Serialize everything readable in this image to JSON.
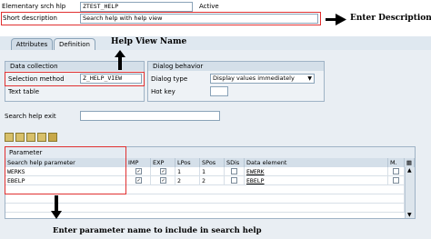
{
  "header": {
    "elem_label": "Elementary srch hlp",
    "elem_value": "ZTEST_HELP",
    "status": "Active",
    "short_desc_label": "Short description",
    "short_desc_value": "Search help with help view"
  },
  "tabs": [
    {
      "label": "Attributes"
    },
    {
      "label": "Definition"
    }
  ],
  "data_collection": {
    "title": "Data collection",
    "selection_method_label": "Selection method",
    "selection_method_value": "Z_HELP_VIEW",
    "text_table_label": "Text table"
  },
  "dialog": {
    "title": "Dialog behavior",
    "type_label": "Dialog type",
    "type_value": "Display values immediately",
    "hot_key_label": "Hot key"
  },
  "exit": {
    "label": "Search help exit"
  },
  "toolbar": {
    "icons": [
      "cut-icon",
      "copy-icon",
      "paste-icon",
      "insert-row-icon"
    ]
  },
  "parameter_table": {
    "group_label": "Parameter",
    "columns": [
      "Search help parameter",
      "IMP",
      "EXP",
      "LPos",
      "SPos",
      "SDis",
      "Data element",
      "M."
    ],
    "rows": [
      {
        "param": "WERKS",
        "imp": "✓",
        "exp": "✓",
        "lpos": "1",
        "spos": "1",
        "sdis": "",
        "element": "EWERK",
        "m": ""
      },
      {
        "param": "EBELP",
        "imp": "✓",
        "exp": "✓",
        "lpos": "2",
        "spos": "2",
        "sdis": "",
        "element": "EBELP",
        "m": ""
      }
    ]
  },
  "annotations": {
    "enter_description": "Enter Description",
    "help_view_name": "Help View Name",
    "enter_parameter": "Enter parameter name to include in search help"
  },
  "colors": {
    "accent_red": "#e03030",
    "panel": "#e9eef3",
    "header_blue": "#d4dfe9"
  }
}
